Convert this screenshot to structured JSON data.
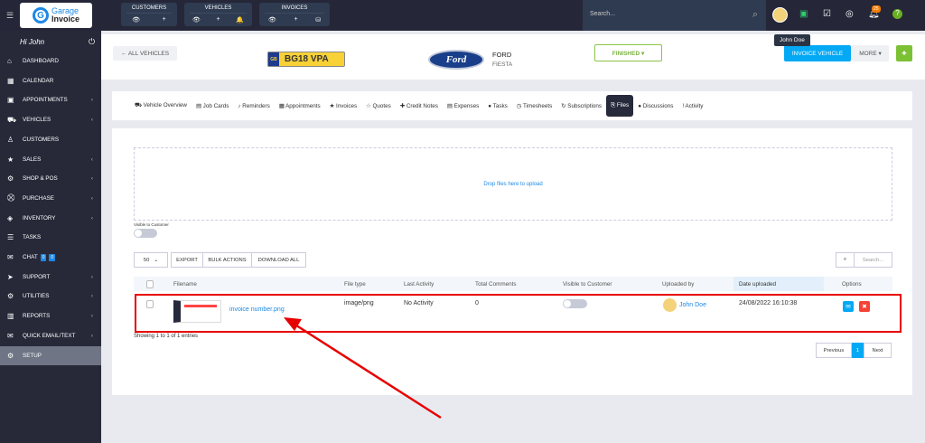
{
  "logo": {
    "line1": "Garage",
    "line2": "Invoice",
    "line3": "PROFESSIONAL"
  },
  "quick": [
    {
      "label": "CUSTOMERS",
      "icons": [
        "eye-icon",
        "plus-icon"
      ]
    },
    {
      "label": "VEHICLES",
      "icons": [
        "eye-icon",
        "plus-icon",
        "bell-icon"
      ]
    },
    {
      "label": "INVOICES",
      "icons": [
        "eye-icon",
        "plus-icon",
        "coins-icon"
      ]
    }
  ],
  "search": {
    "placeholder": "Search..."
  },
  "notifications": {
    "count": "25"
  },
  "tooltip": "John Doe",
  "sidebar": {
    "greeting": "Hi John",
    "items": [
      {
        "label": "DASHBOARD",
        "icon": "⌂"
      },
      {
        "label": "CALENDAR",
        "icon": "▦"
      },
      {
        "label": "APPOINTMENTS",
        "icon": "▣",
        "chev": true
      },
      {
        "label": "VEHICLES",
        "icon": "⛟",
        "chev": true
      },
      {
        "label": "CUSTOMERS",
        "icon": "♙"
      },
      {
        "label": "SALES",
        "icon": "★",
        "chev": true
      },
      {
        "label": "SHOP & POS",
        "icon": "⚙",
        "chev": true
      },
      {
        "label": "PURCHASE",
        "icon": "⛒",
        "chev": true
      },
      {
        "label": "INVENTORY",
        "icon": "◈",
        "chev": true
      },
      {
        "label": "TASKS",
        "icon": "☰"
      },
      {
        "label": "CHAT",
        "icon": "✉",
        "badges": [
          "0",
          "0"
        ]
      },
      {
        "label": "SUPPORT",
        "icon": "➤",
        "chev": true
      },
      {
        "label": "UTILITIES",
        "icon": "⚙",
        "chev": true
      },
      {
        "label": "REPORTS",
        "icon": "▥",
        "chev": true
      },
      {
        "label": "QUICK EMAIL/TEXT",
        "icon": "✉",
        "chev": true
      },
      {
        "label": "SETUP",
        "icon": "⚙",
        "active": true
      }
    ]
  },
  "header": {
    "back": "← ALL VEHICLES",
    "plate_country": "GB",
    "plate": "BG18 VPA",
    "make": "FORD",
    "model": "FIESTA",
    "logo_text": "Ford",
    "status": "FINISHED ▾",
    "invoice": "INVOICE VEHICLE",
    "more": "MORE ▾",
    "pin": "📌"
  },
  "tabs": [
    {
      "icon": "⛟",
      "label": "Vehicle Overview"
    },
    {
      "icon": "▤",
      "label": "Job Cards"
    },
    {
      "icon": "♪",
      "label": "Reminders"
    },
    {
      "icon": "▦",
      "label": "Appointments"
    },
    {
      "icon": "★",
      "label": "Invoices"
    },
    {
      "icon": "☆",
      "label": "Quotes"
    },
    {
      "icon": "✚",
      "label": "Credit Notes"
    },
    {
      "icon": "▤",
      "label": "Expenses"
    },
    {
      "icon": "●",
      "label": "Tasks"
    },
    {
      "icon": "◷",
      "label": "Timesheets"
    },
    {
      "icon": "↻",
      "label": "Subscriptions"
    },
    {
      "icon": "⎘",
      "label": "Files",
      "active": true
    },
    {
      "icon": "●",
      "label": "Discussions"
    },
    {
      "icon": "!",
      "label": "Activity"
    }
  ],
  "files": {
    "drop": "Drop files here to upload",
    "visible_label": "Visible to Customer",
    "visible": false,
    "page_size": "50",
    "export": "EXPORT",
    "bulk": "BULK ACTIONS",
    "download_all": "DOWNLOAD ALL",
    "search_placeholder": "Search...",
    "columns": [
      "Filename",
      "File type",
      "Last Activity",
      "Total Comments",
      "Visible to Customer",
      "Uploaded by",
      "Date uploaded",
      "Options"
    ],
    "rows": [
      {
        "filename": "invoice number.png",
        "type": "image/png",
        "last_activity": "No Activity",
        "comments": "0",
        "visible": false,
        "uploaded_by": "John Doe",
        "date": "24/08/2022 16:10:38"
      }
    ],
    "showing": "Showing 1 to 1 of 1 entries",
    "prev": "Previous",
    "page": "1",
    "next": "Next"
  },
  "colors": {
    "accent": "#1e88e5",
    "highlight": "#e80000",
    "finished": "#8bc34a"
  }
}
